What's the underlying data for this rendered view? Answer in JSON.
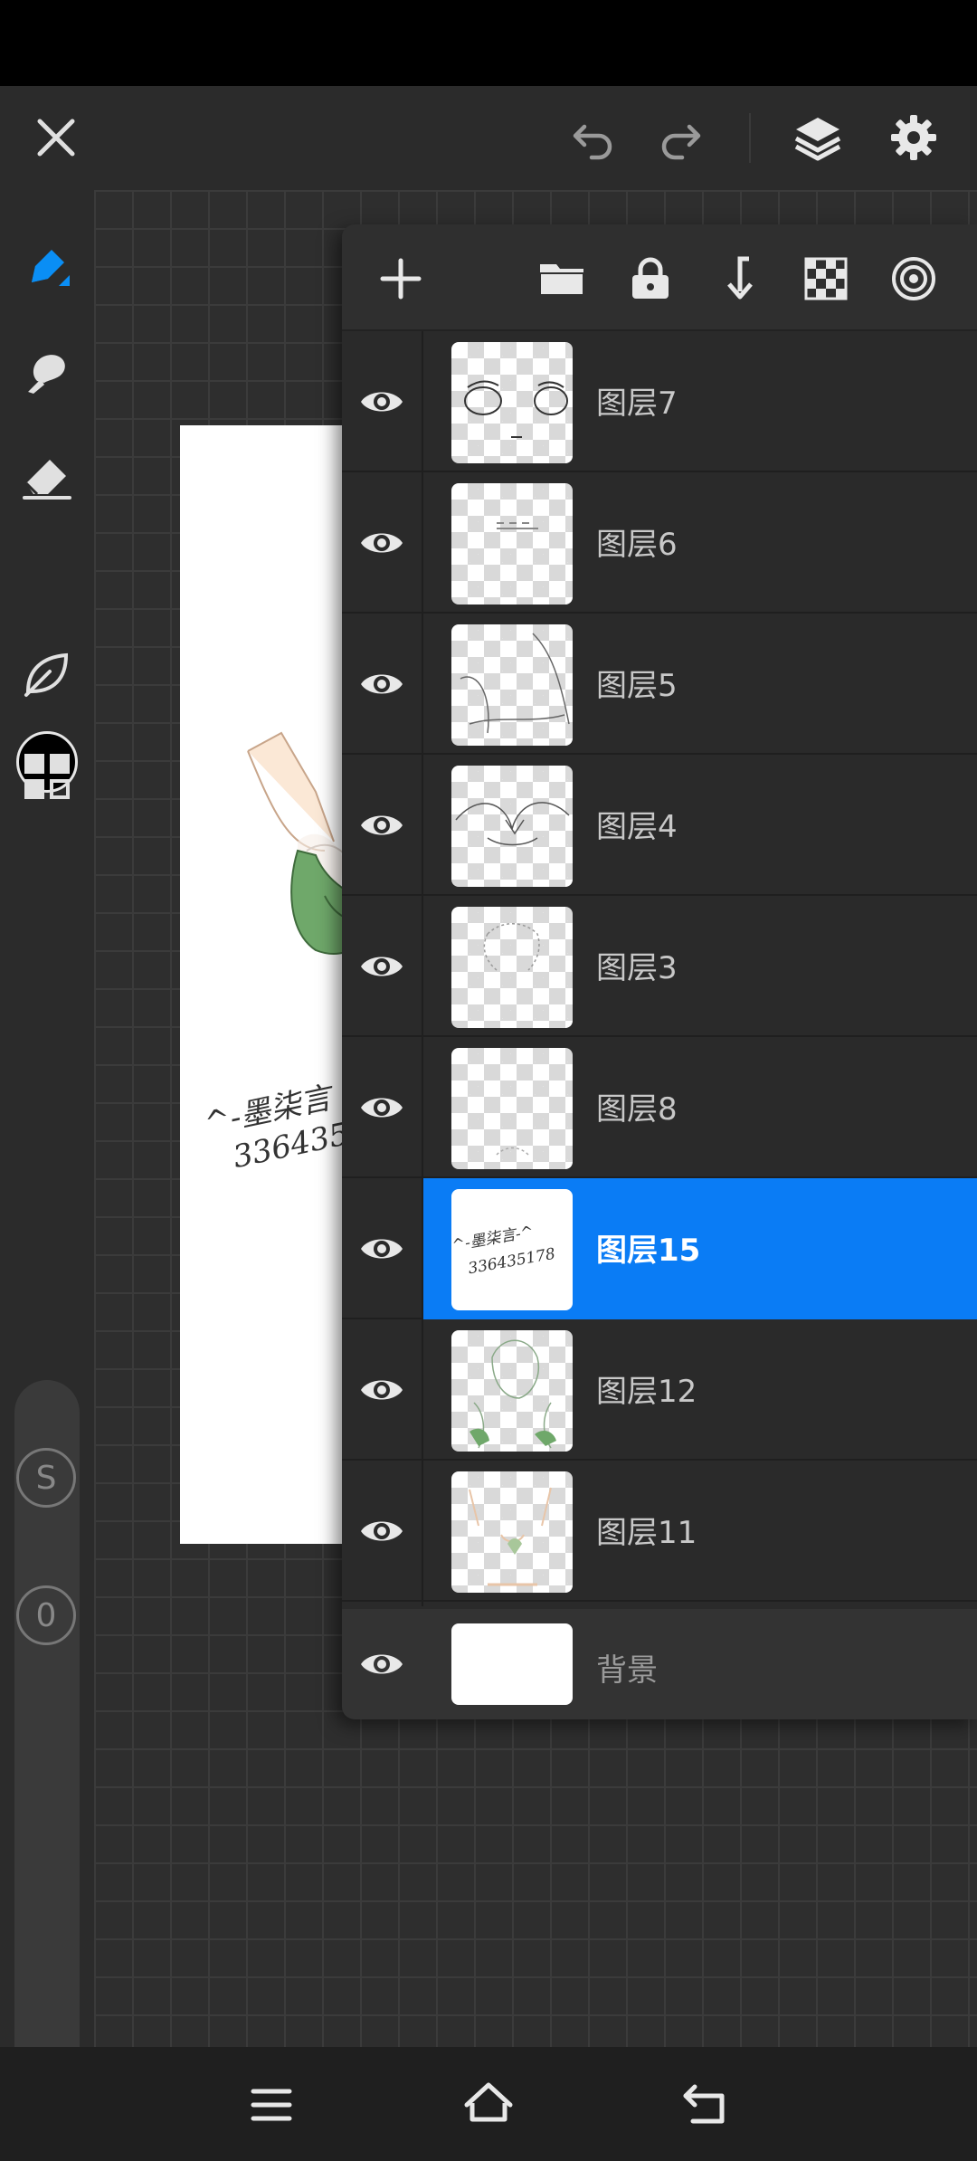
{
  "toolbar": {
    "close_icon": "close-icon",
    "undo_icon": "undo-icon",
    "redo_icon": "redo-icon",
    "layers_icon": "layers-icon",
    "settings_icon": "gear-icon"
  },
  "left_tools": {
    "items": [
      "brush-icon",
      "smudge-icon",
      "eraser-icon",
      "color-swatch",
      "leaf-icon",
      "grid-icon"
    ],
    "current_color": "#000000",
    "size_badge": "S",
    "opacity_badge": "0"
  },
  "artwork": {
    "signature_line1": "^-墨柒言",
    "signature_line2": "336435"
  },
  "layers_panel": {
    "header_icons": [
      "add-icon",
      "folder-icon",
      "lock-icon",
      "merge-down-icon",
      "checker-icon",
      "target-icon"
    ],
    "layers": [
      {
        "name": "图层7",
        "visible": true,
        "selected": false
      },
      {
        "name": "图层6",
        "visible": true,
        "selected": false
      },
      {
        "name": "图层5",
        "visible": true,
        "selected": false
      },
      {
        "name": "图层4",
        "visible": true,
        "selected": false
      },
      {
        "name": "图层3",
        "visible": true,
        "selected": false
      },
      {
        "name": "图层8",
        "visible": true,
        "selected": false
      },
      {
        "name": "图层15",
        "visible": true,
        "selected": true
      },
      {
        "name": "图层12",
        "visible": true,
        "selected": false
      },
      {
        "name": "图层11",
        "visible": true,
        "selected": false
      }
    ],
    "thumb15_line1": "^-墨柒言-^",
    "thumb15_line2": "336435178",
    "background": {
      "name": "背景",
      "visible": true
    }
  },
  "nav": {
    "menu_icon": "menu-icon",
    "home_icon": "home-icon",
    "back_icon": "back-icon"
  },
  "colors": {
    "accent": "#0a7cf5",
    "panel": "#2a2a2a",
    "bar": "#2b2b2b"
  }
}
